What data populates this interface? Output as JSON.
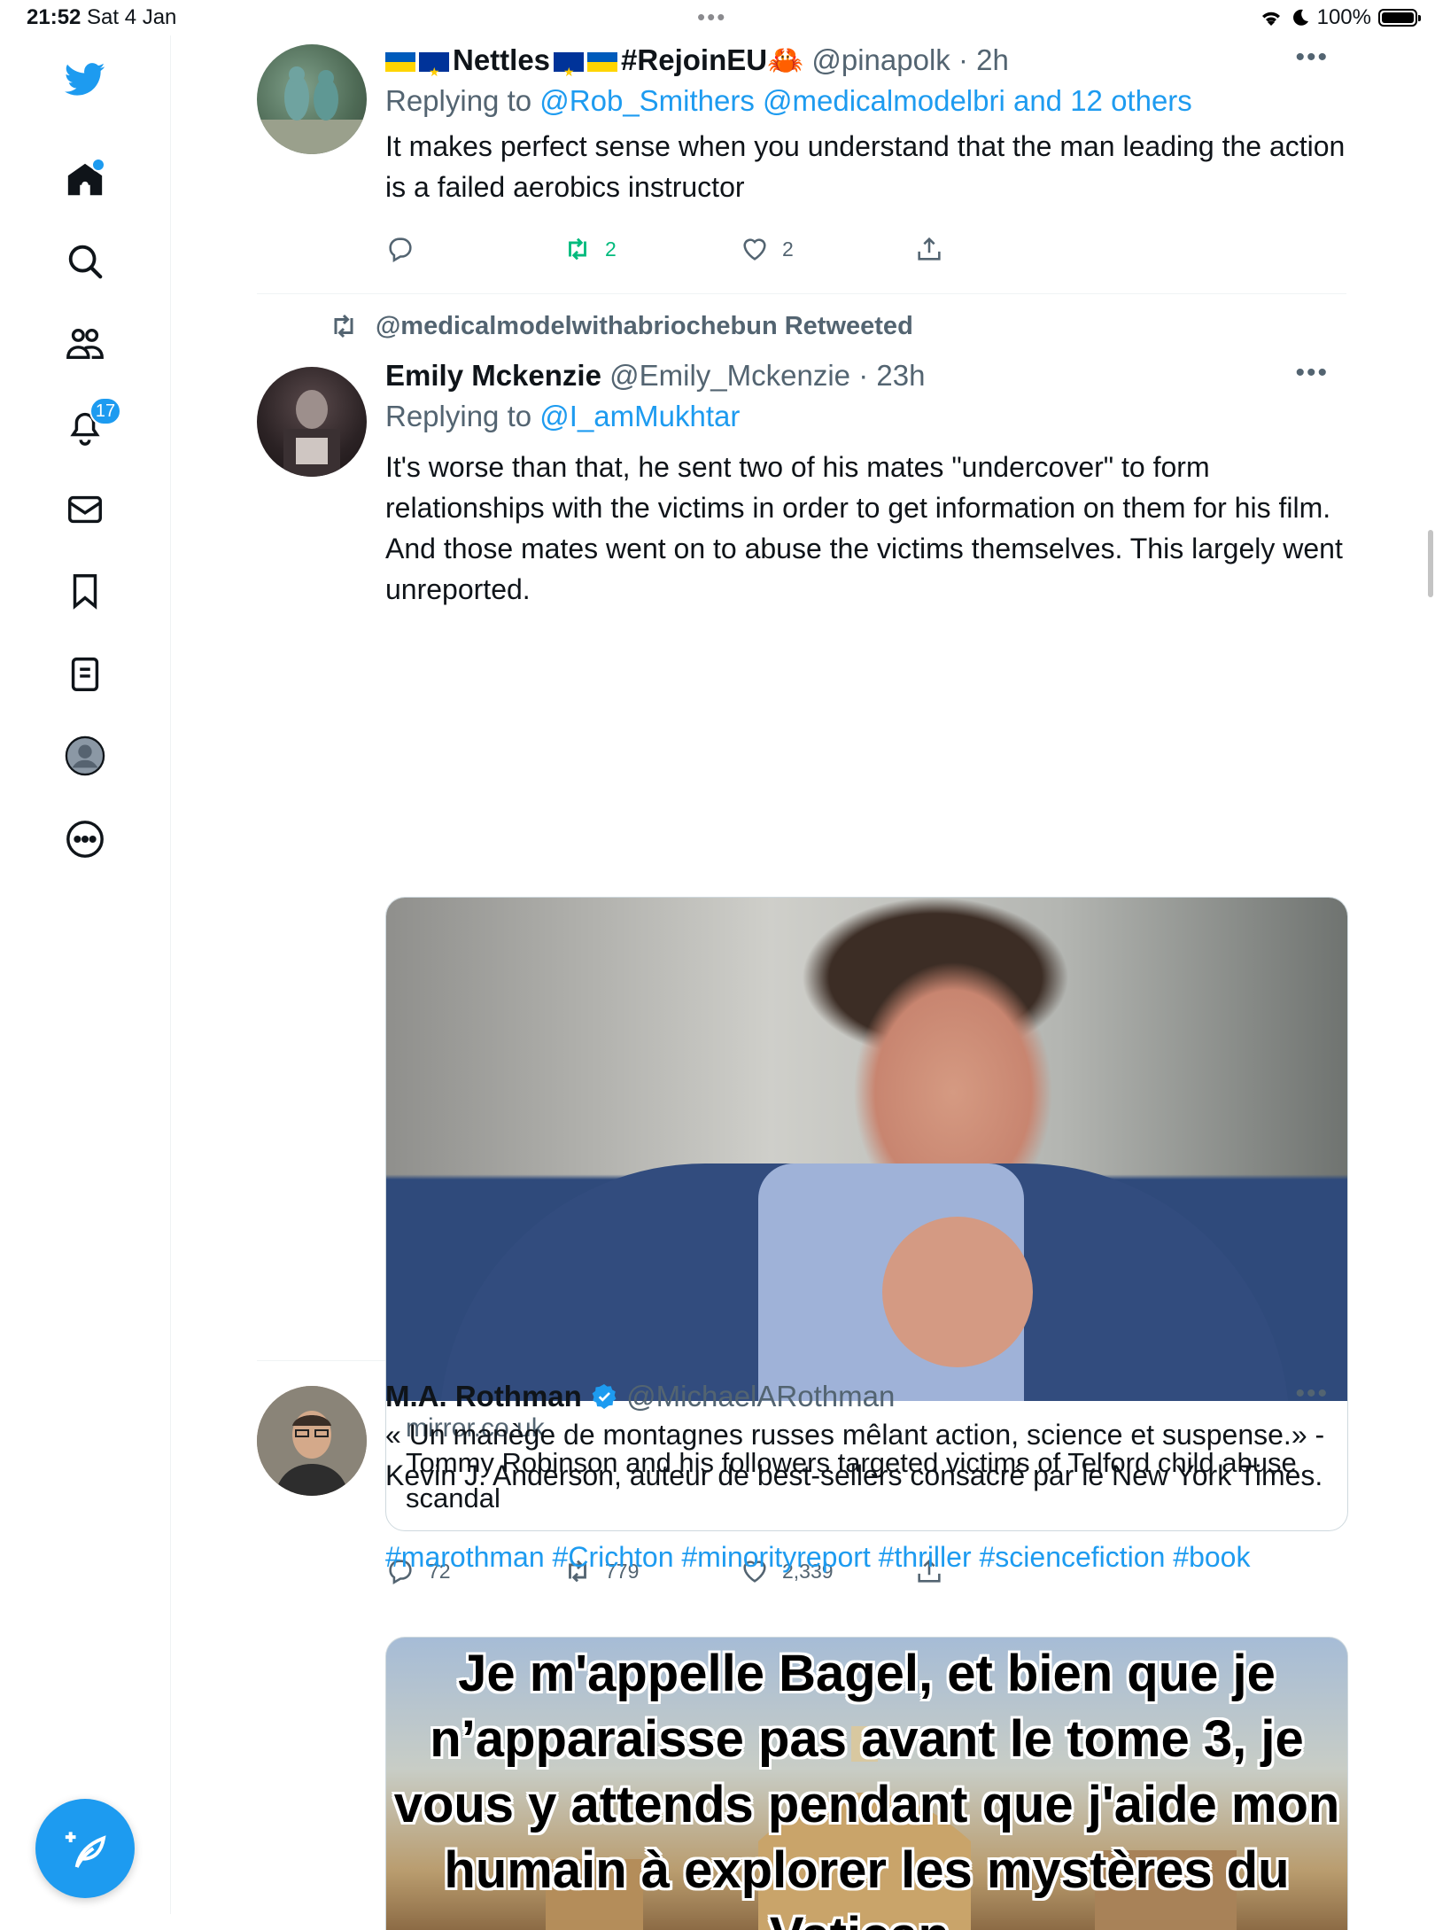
{
  "status_bar": {
    "time": "21:52",
    "date": "Sat 4 Jan",
    "battery": "100%",
    "battery_level": 1.0
  },
  "sidebar": {
    "icons": [
      "twitter-logo-icon",
      "home-icon",
      "search-icon",
      "communities-icon",
      "notifications-icon",
      "messages-icon",
      "bookmarks-icon",
      "lists-icon",
      "profile-icon",
      "more-icon"
    ],
    "notifications_badge": "17",
    "compose_icon": "compose-tweet-icon"
  },
  "tweets": [
    {
      "name_prefix_flags": [
        "ua",
        "eu"
      ],
      "name": "Nettles",
      "name_suffix": "#RejoinEU",
      "name_emoji": "🦀",
      "handle": "@pinapolk",
      "time": "· 2h",
      "replying_prefix": "Replying to",
      "replying_to": "@Rob_Smithers @medicalmodelbri and 12 others",
      "text": "It makes perfect sense when you understand that the man leading the action is a failed aerobics instructor",
      "replies": "",
      "retweets": "2",
      "likes": "2"
    },
    {
      "retweeted_by": "@medicalmodelwithabriochebun Retweeted",
      "name": "Emily Mckenzie",
      "handle": "@Emily_Mckenzie",
      "time": "· 23h",
      "replying_prefix": "Replying to",
      "replying_to": "@I_amMukhtar",
      "text": "It's worse than that, he sent two of his mates \"undercover\" to form relationships with the victims in order to get information on them for his film. And those mates went on to abuse the victims themselves. This largely went unreported.",
      "card": {
        "domain": "mirror.co.uk",
        "title": "Tommy Robinson and his followers targeted victims of Telford child abuse scandal"
      },
      "replies": "72",
      "retweets": "779",
      "likes": "2,339"
    },
    {
      "name": "M.A. Rothman",
      "verified": true,
      "handle": "@MichaelARothman",
      "text": "« Un manège de montagnes russes mêlant action, science et suspense.» - Kevin J. Anderson, auteur de best-sellers consacré par le New York Times.",
      "hashtags": "#marothman #Crichton #minorityreport #thriller #sciencefiction #book",
      "media_text": "Je m'appelle Bagel, et bien que je n’apparaisse pas avant le tome 3, je vous y attends pendant que j'aide mon humain à explorer les mystères du Vatican."
    }
  ],
  "colors": {
    "accent": "#1d9bf0",
    "retweet_green": "#00ba7c",
    "secondary_text": "#536471",
    "divider": "#eff3f4"
  }
}
